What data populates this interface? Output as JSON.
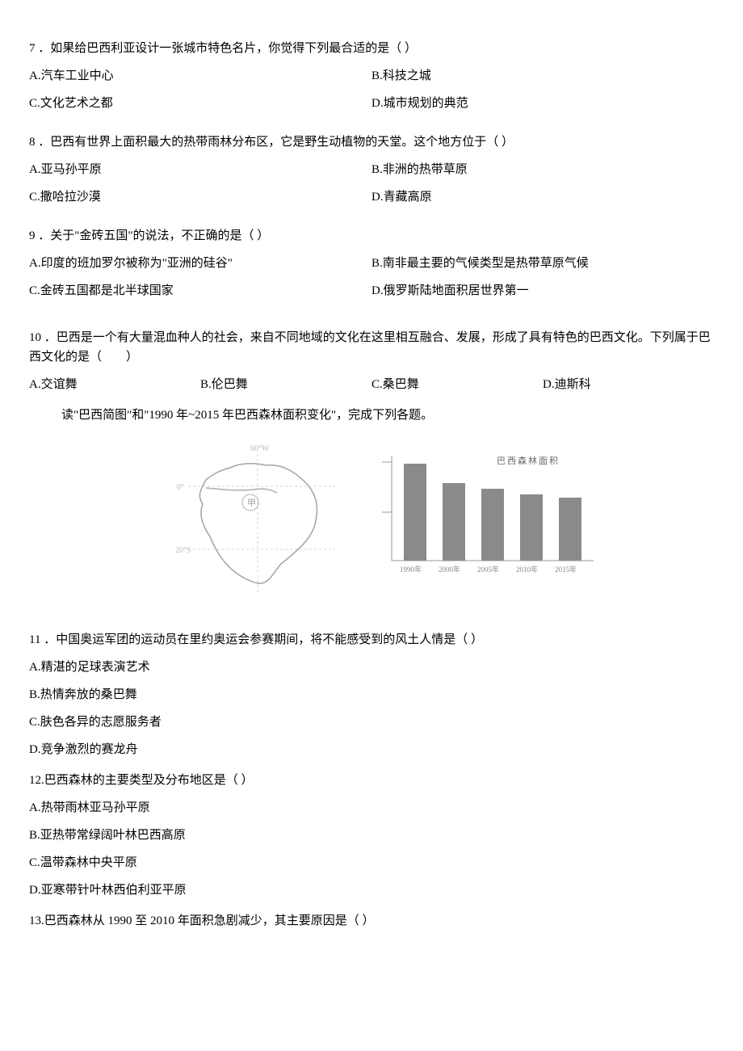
{
  "q7": {
    "stem": "7 ．如果给巴西利亚设计一张城市特色名片，你觉得下列最合适的是（ ）",
    "A": "A.汽车工业中心",
    "B": "B.科技之城",
    "C": "C.文化艺术之都",
    "D": "D.城市规划的典范"
  },
  "q8": {
    "stem": "8 ．巴西有世界上面积最大的热带雨林分布区，它是野生动植物的天堂。这个地方位于（ ）",
    "A": "A.亚马孙平原",
    "B": "B.非洲的热带草原",
    "C": "C.撒哈拉沙漠",
    "D": "D.青藏高原"
  },
  "q9": {
    "stem": "9 ．关于\"金砖五国\"的说法，不正确的是（ ）",
    "A": "A.印度的班加罗尔被称为\"亚洲的硅谷\"",
    "B": "B.南非最主要的气候类型是热带草原气候",
    "C": "C.金砖五国都是北半球国家",
    "D": "D.俄罗斯陆地面积居世界第一"
  },
  "q10": {
    "stem": "10 ．巴西是一个有大量混血种人的社会，来自不同地域的文化在这里相互融合、发展，形成了具有特色的巴西文化。下列属于巴西文化的是（　　）",
    "A": "A.交谊舞",
    "B": "B.伦巴舞",
    "C": "C.桑巴舞",
    "D": "D.迪斯科"
  },
  "reading": "读\"巴西简图\"和\"1990 年~2015 年巴西森林面积变化\"，完成下列各题。",
  "q11": {
    "stem": "11 ．中国奥运军团的运动员在里约奥运会参赛期间，将不能感受到的风土人情是（ ）",
    "A": "A.精湛的足球表演艺术",
    "B": "B.热情奔放的桑巴舞",
    "C": "C.肤色各异的志愿服务者",
    "D": "D.竞争激烈的赛龙舟"
  },
  "q12": {
    "stem": "12.巴西森林的主要类型及分布地区是（ ）",
    "A": "A.热带雨林亚马孙平原",
    "B": "B.亚热带常绿阔叶林巴西高原",
    "C": "C.温带森林中央平原",
    "D": "D.亚寒带针叶林西伯利亚平原"
  },
  "q13": {
    "stem": "13.巴西森林从 1990 至 2010 年面积急剧减少，其主要原因是（ ）"
  },
  "map_labels": {
    "lon60w": "60°W",
    "lat0": "0°",
    "lat20s": "20°S",
    "circle": "甲"
  },
  "chart_data": {
    "type": "bar",
    "title": "巴西森林面积",
    "subtitle": "",
    "categories": [
      "1990年",
      "2000年",
      "2005年",
      "2010年",
      "2015年"
    ],
    "values": [
      100,
      80,
      74,
      68,
      65
    ],
    "ylim": [
      0,
      110
    ]
  }
}
